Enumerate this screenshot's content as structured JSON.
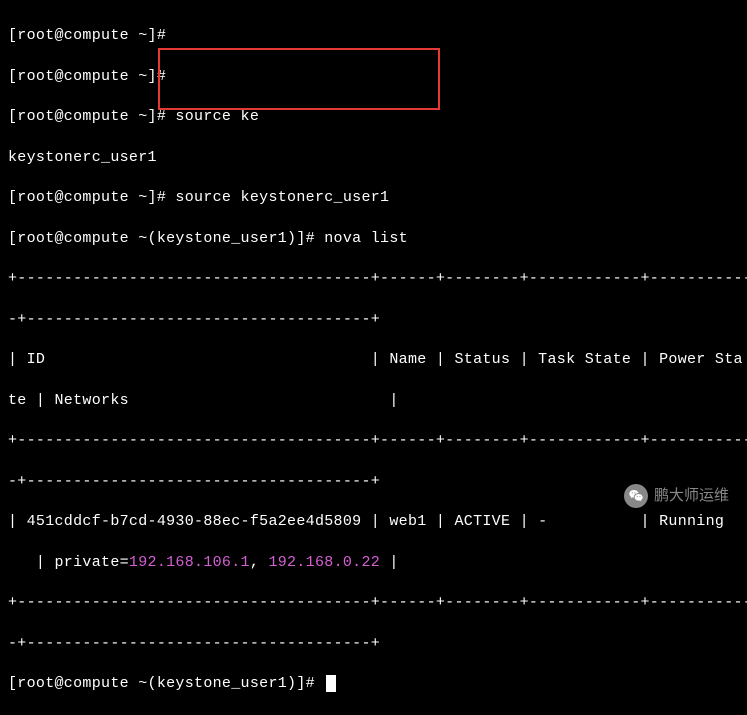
{
  "lines": {
    "l0": "[root@compute ~]#",
    "l1": "[root@compute ~]#",
    "l2": "[root@compute ~]# source ke",
    "l3": "keystonerc_user1",
    "l4": "[root@compute ~]# source keystonerc_user1",
    "l5": "[root@compute ~(keystone_user1)]# nova list",
    "l6": "+--------------------------------------+------+--------+------------+------------",
    "l7": "-+-------------------------------------+",
    "l8": "| ID                                   | Name | Status | Task State | Power Sta",
    "l9": "te | Networks                            |",
    "l10": "+--------------------------------------+------+--------+------------+------------",
    "l11": "-+-------------------------------------+",
    "l12a": "| 451cddcf-b7cd-4930-88ec-f5a2ee4d5809 | web1 | ACTIVE | -          | Running",
    "l13a": "   | private=",
    "ip1": "192.168.106.1",
    "comma": ", ",
    "ip2": "192.168.0.22",
    "l13b": " |",
    "l14": "+--------------------------------------+------+--------+------------+------------",
    "l15": "-+-------------------------------------+",
    "l16": "[root@compute ~(keystone_user1)]# "
  },
  "watermark": {
    "text": "鹏大师运维"
  },
  "table_data": {
    "headers": [
      "ID",
      "Name",
      "Status",
      "Task State",
      "Power State",
      "Networks"
    ],
    "rows": [
      {
        "ID": "451cddcf-b7cd-4930-88ec-f5a2ee4d5809",
        "Name": "web1",
        "Status": "ACTIVE",
        "Task State": "-",
        "Power State": "Running",
        "Networks": "private=192.168.106.1, 192.168.0.22"
      }
    ]
  },
  "commands": [
    "source ke",
    "source keystonerc_user1",
    "nova list"
  ]
}
